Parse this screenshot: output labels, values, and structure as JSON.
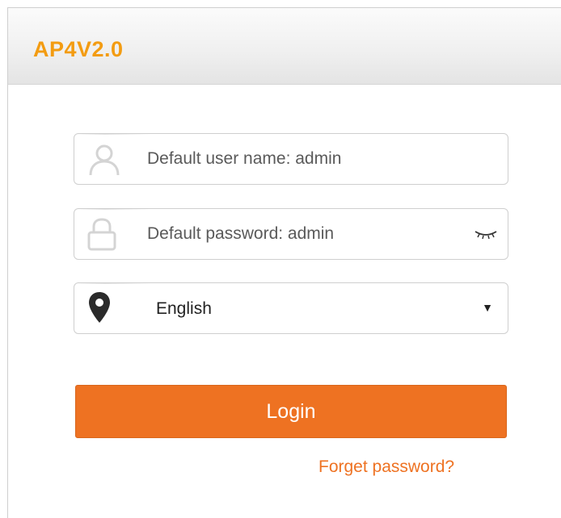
{
  "header": {
    "brand": "AP4V2.0"
  },
  "login_form": {
    "username": {
      "placeholder": "Default user name: admin",
      "icon": "user-icon"
    },
    "password": {
      "placeholder": "Default password: admin",
      "icon": "lock-icon",
      "toggle_icon": "eye-closed-icon"
    },
    "language": {
      "selected": "English",
      "icon": "location-pin-icon"
    },
    "login_label": "Login",
    "forget_label": "Forget password?"
  },
  "colors": {
    "brand": "#f39c12",
    "accent": "#ee7222"
  }
}
